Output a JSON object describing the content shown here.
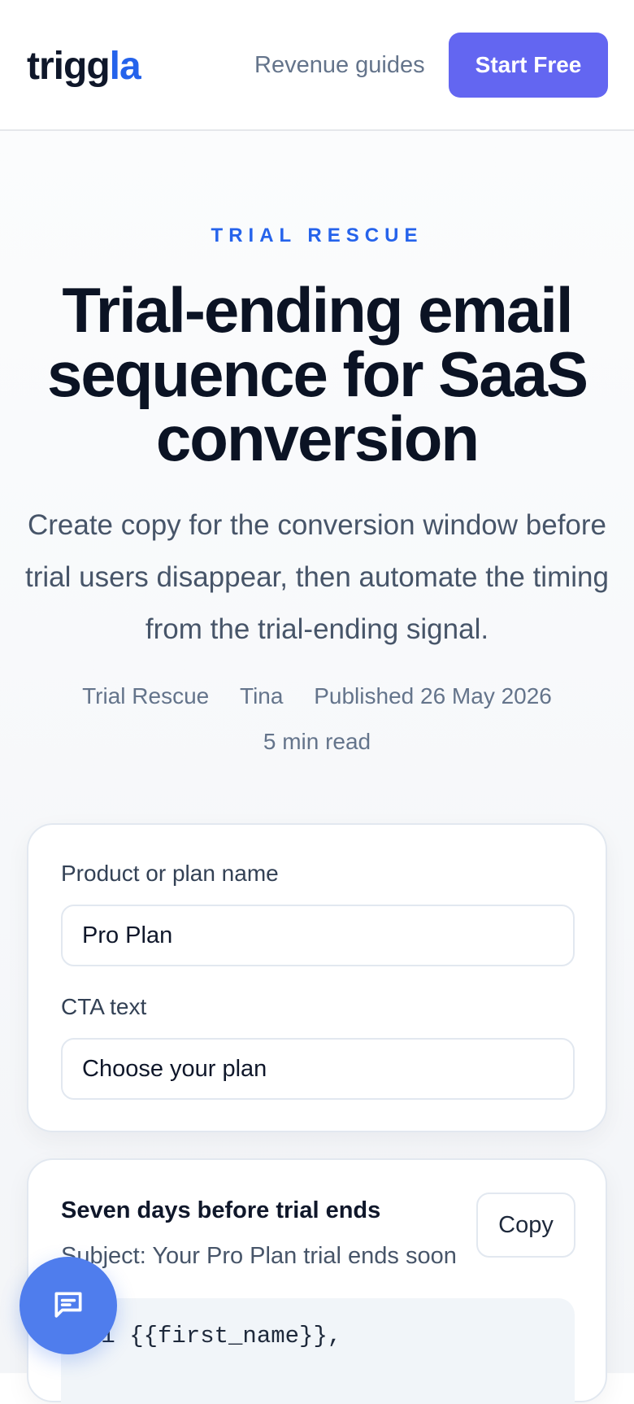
{
  "header": {
    "logo_main": "trigg",
    "logo_accent": "la",
    "nav_link": "Revenue guides",
    "cta_label": "Start Free"
  },
  "hero": {
    "eyebrow": "TRIAL RESCUE",
    "title": "Trial-ending email sequence for SaaS conversion",
    "lede": "Create copy for the conversion window before trial users disappear, then automate the timing from the trial-ending signal.",
    "meta": {
      "category": "Trial Rescue",
      "author": "Tina",
      "published": "Published 26 May 2026",
      "read_time": "5 min read"
    }
  },
  "form": {
    "product_label": "Product or plan name",
    "product_value": "Pro Plan",
    "cta_label": "CTA text",
    "cta_value": "Choose your plan"
  },
  "email": {
    "title": "Seven days before trial ends",
    "subject": "Subject: Your Pro Plan trial ends soon",
    "copy_label": "Copy",
    "body_first_line": "Hi {{first_name}},"
  },
  "chat": {
    "icon": "chat-icon"
  },
  "colors": {
    "brand_accent": "#2563eb",
    "cta": "#6366f1",
    "chat": "#4f7ded"
  }
}
